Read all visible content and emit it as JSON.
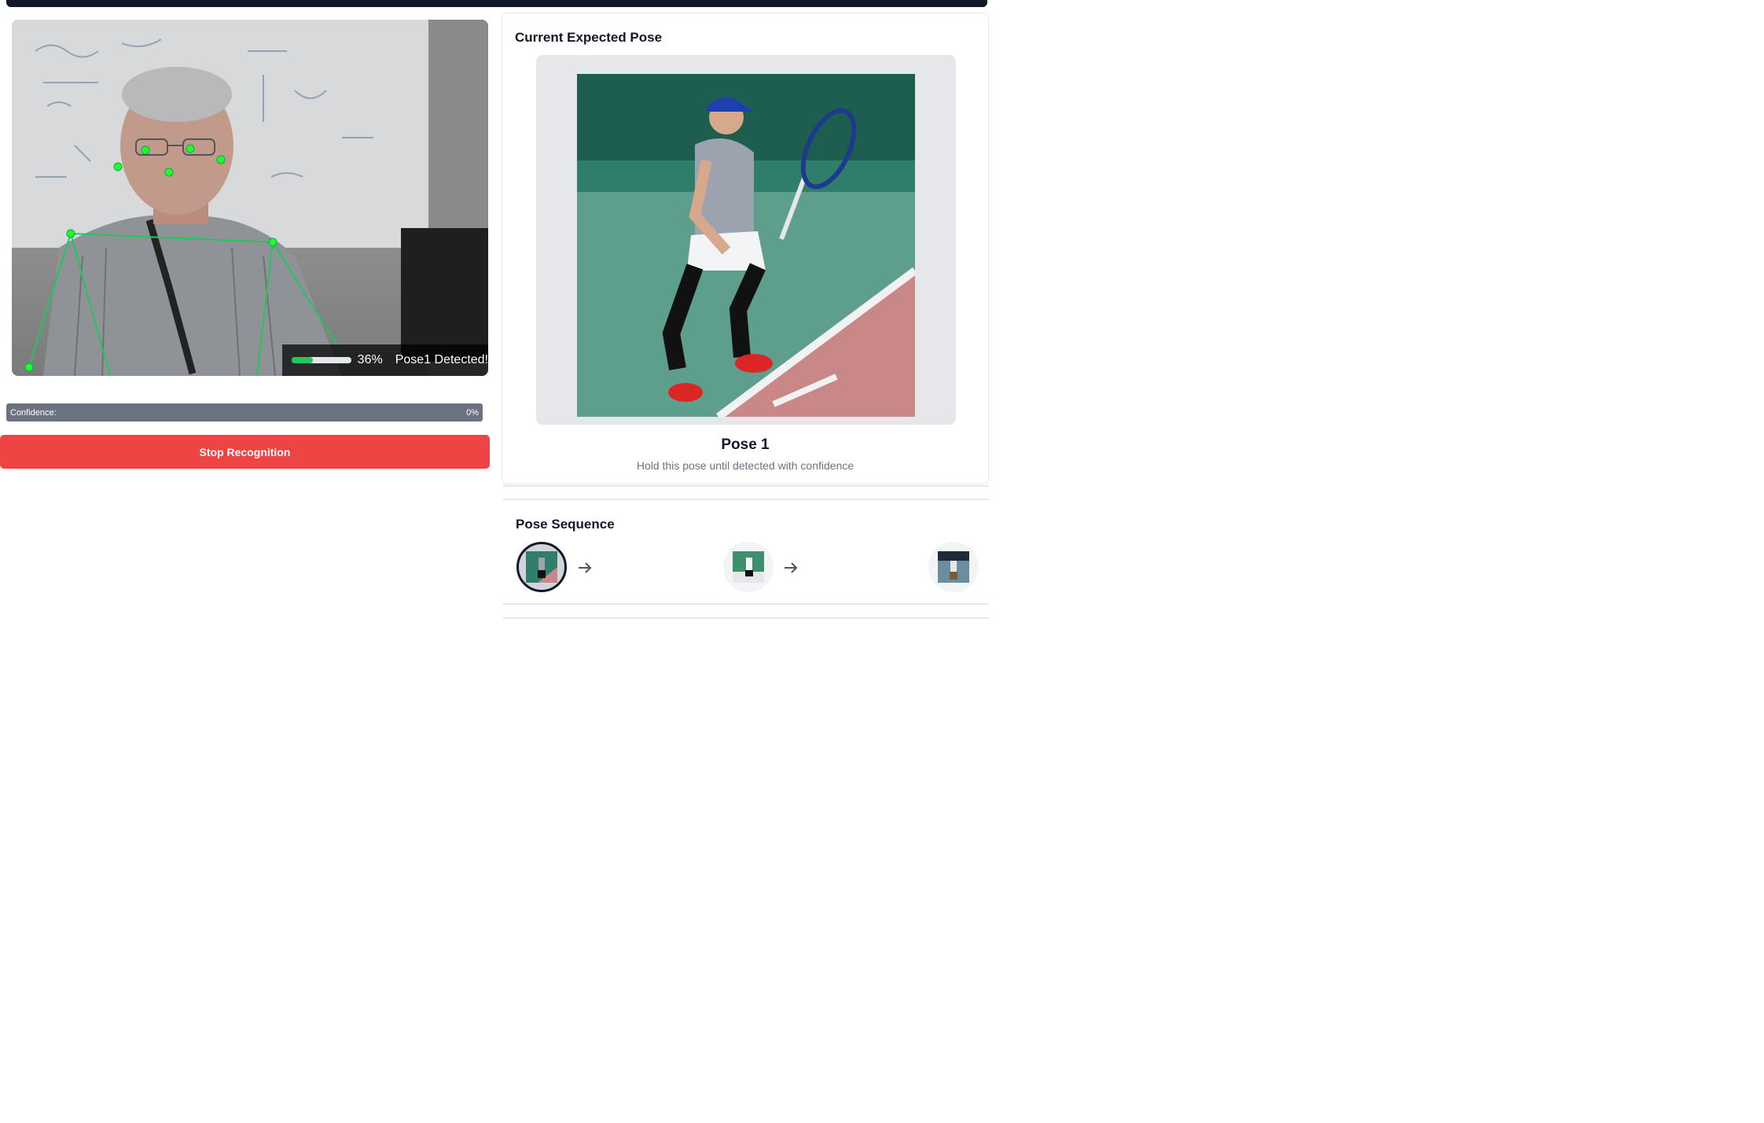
{
  "camera": {
    "progress_percent": 36,
    "progress_text": "36%",
    "detected_label": "Pose1 Detected!"
  },
  "confidence": {
    "label": "Confidence:",
    "value_text": "0%"
  },
  "stop_button": {
    "label": "Stop Recognition"
  },
  "current_pose": {
    "section_title": "Current Expected Pose",
    "pose_name": "Pose 1",
    "hint": "Hold this pose until detected with confidence"
  },
  "sequence": {
    "section_title": "Pose Sequence",
    "items": [
      {
        "icon": "pose-thumbnail",
        "active": true
      },
      {
        "icon": "pose-thumbnail",
        "active": false
      },
      {
        "icon": "pose-thumbnail",
        "active": false
      }
    ],
    "arrow_icon": "arrow-right-icon"
  },
  "colors": {
    "top_bar": "#111827",
    "stop_button": "#ef4444",
    "skeleton": "#22c55e",
    "confidence_bar": "#6b7280"
  }
}
